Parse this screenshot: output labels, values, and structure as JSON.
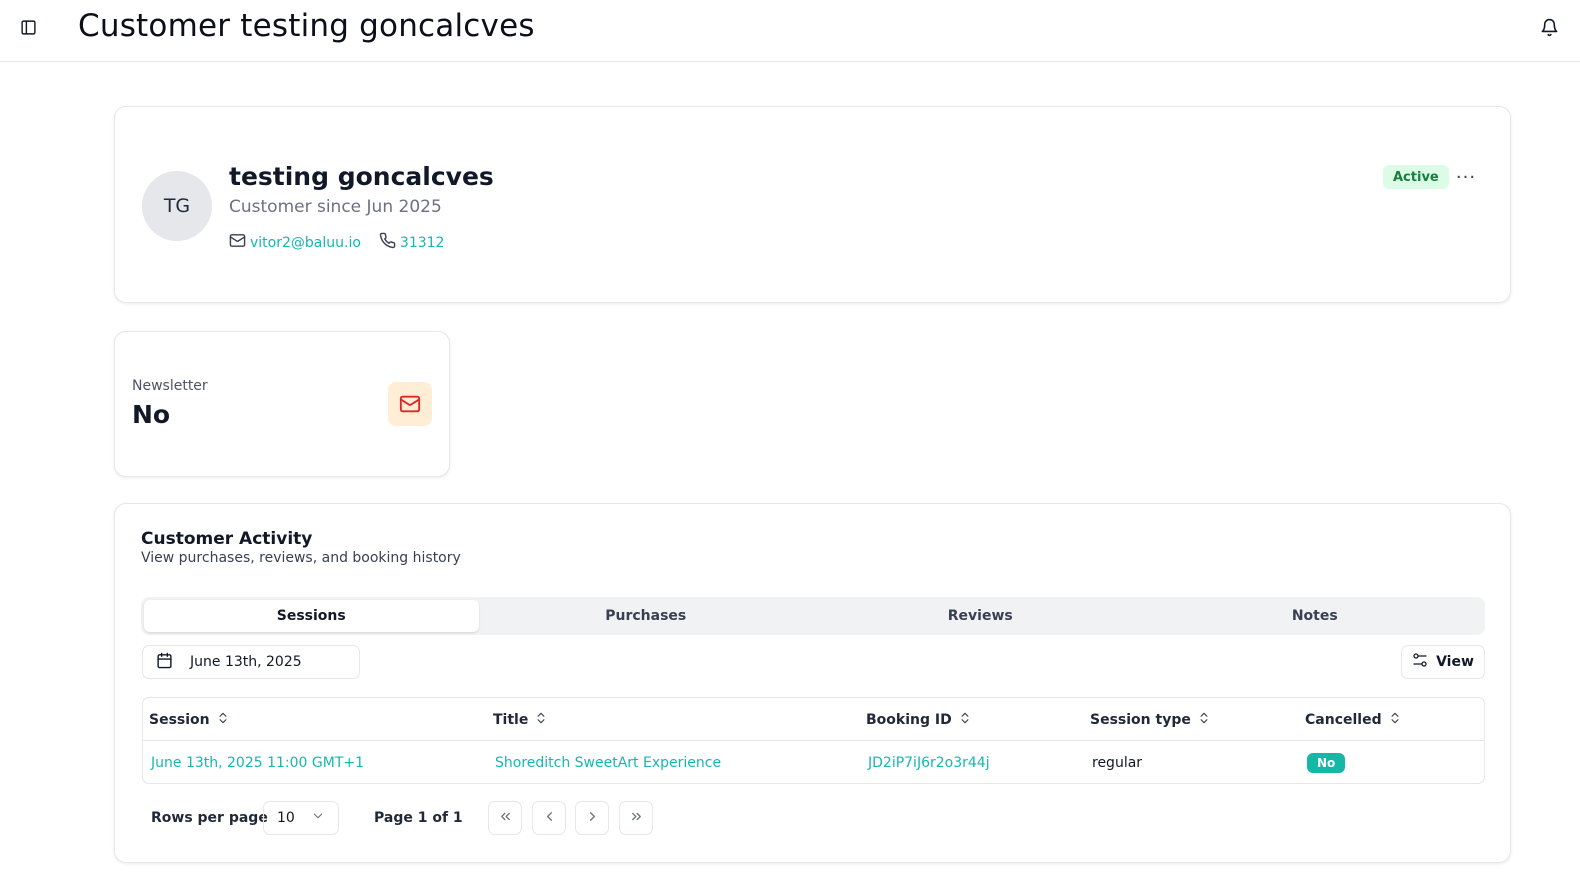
{
  "header": {
    "title": "Customer testing goncalcves",
    "sidebar_toggle_icon": "sidebar-panel-icon",
    "bell_icon": "bell-icon"
  },
  "profile": {
    "initials": "TG",
    "name": "testing goncalcves",
    "since": "Customer since Jun 2025",
    "email": "vitor2@baluu.io",
    "phone": "31312",
    "status": "Active",
    "more": "···"
  },
  "newsletter": {
    "label": "Newsletter",
    "value": "No",
    "icon": "mail-icon"
  },
  "activity": {
    "title": "Customer Activity",
    "subtitle": "View purchases, reviews, and booking history",
    "tabs": [
      {
        "label": "Sessions",
        "active": true
      },
      {
        "label": "Purchases",
        "active": false
      },
      {
        "label": "Reviews",
        "active": false
      },
      {
        "label": "Notes",
        "active": false
      }
    ],
    "date_filter": "June 13th, 2025",
    "view_label": "View",
    "columns": [
      "Session",
      "Title",
      "Booking ID",
      "Session type",
      "Cancelled"
    ],
    "rows": [
      {
        "session": "June 13th, 2025 11:00 GMT+1",
        "title": "Shoreditch SweetArt Experience",
        "booking_id": "JD2iP7iJ6r2o3r44j",
        "session_type": "regular",
        "cancelled": "No"
      }
    ],
    "pagination": {
      "rows_label": "Rows per page",
      "rows_value": "10",
      "page_label": "Page 1 of 1"
    }
  },
  "colors": {
    "accent": "#14b8b0",
    "active_badge_bg": "#dcfce7",
    "active_badge_text": "#15803d",
    "newsletter_icon_bg": "#ffedd5",
    "newsletter_icon": "#dc2626"
  }
}
